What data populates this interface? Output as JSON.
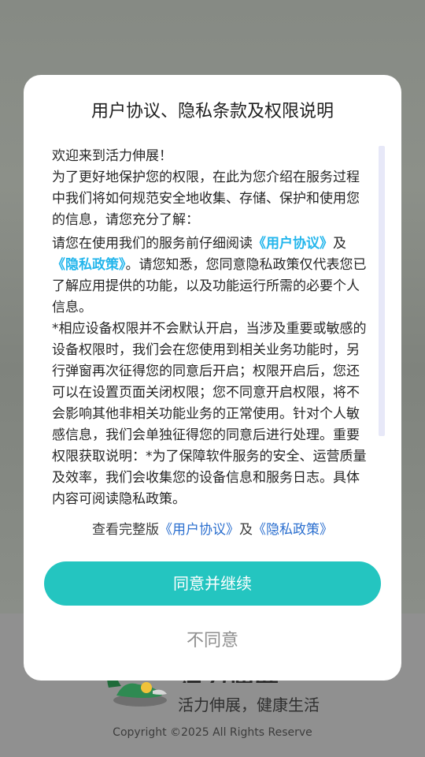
{
  "background": {
    "app_name": "活力伸展",
    "slogan": "活力伸展，健康生活",
    "copyright": "Copyright ©2025 All Rights Reserve"
  },
  "dialog": {
    "title": "用户协议、隐私条款及权限说明",
    "p1": "欢迎来到活力伸展！",
    "p2": "为了更好地保护您的权限，在此为您介绍在服务过程中我们将如何规范安全地收集、存储、保护和使用您的信息，请您充分了解：",
    "p3_prefix": "请您在使用我们的服务前仔细阅读",
    "p3_link1": "《用户协议》",
    "p3_mid": "及",
    "p3_link2": "《隐私政策》",
    "p3_suffix": "。请您知悉，您同意隐私政策仅代表您已了解应用提供的功能，以及功能运行所需的必要个人信息。",
    "p4": "*相应设备权限并不会默认开启，当涉及重要或敏感的设备权限时，我们会在您使用到相关业务功能时，另行弹窗再次征得您的同意后开启；权限开启后，您还可以在设置页面关闭权限；您不同意开启权限，将不会影响其他非相关功能业务的正常使用。针对个人敏感信息，我们会单独征得您的同意后进行处理。重要权限获取说明：*为了保障软件服务的安全、运营质量及效率，我们会收集您的设备信息和服务日志。具体内容可阅读隐私政策。"
  },
  "footer": {
    "prefix": "查看完整版",
    "user_agreement": "《用户协议》",
    "and": "及",
    "privacy_policy": "《隐私政策》"
  },
  "buttons": {
    "agree": "同意并继续",
    "disagree": "不同意"
  },
  "colors": {
    "accent": "#24c5c0",
    "link_strong": "#24b6ec",
    "link": "#2b6fcf"
  }
}
